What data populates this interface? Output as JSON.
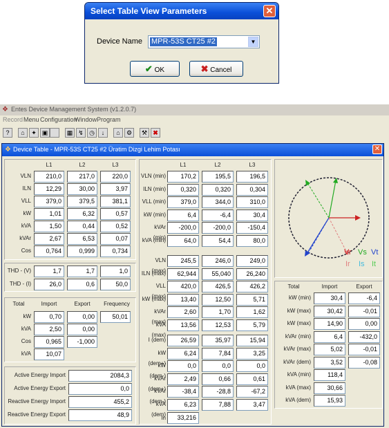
{
  "dialog": {
    "title": "Select Table View Parameters",
    "device_label": "Device Name",
    "device_value": "MPR-53S CT25 #2",
    "ok": "OK",
    "cancel": "Cancel"
  },
  "app": {
    "title": "Entes Device Management System  (v1.2.0.7)",
    "menu": [
      "Record",
      "Menu",
      "Configuration",
      "Window",
      "Program"
    ],
    "child_title": "Device Table - MPR-53S CT25 #2 Ürətim Dizgi Lehim Potası"
  },
  "left": {
    "phase_headers": [
      "L1",
      "L2",
      "L3"
    ],
    "rows": [
      {
        "label": "VLN",
        "values": [
          "210,0",
          "217,0",
          "220,0"
        ]
      },
      {
        "label": "ILN",
        "values": [
          "12,29",
          "30,00",
          "3,97"
        ]
      },
      {
        "label": "VLL",
        "values": [
          "379,0",
          "379,5",
          "381,1"
        ]
      },
      {
        "label": "kW",
        "values": [
          "1,01",
          "6,32",
          "0,57"
        ]
      },
      {
        "label": "kVA",
        "values": [
          "1,50",
          "0,44",
          "0,52"
        ]
      },
      {
        "label": "kVAr",
        "values": [
          "2,67",
          "6,53",
          "0,07"
        ]
      },
      {
        "label": "Cos",
        "values": [
          "0,764",
          "0,999",
          "0,734"
        ]
      }
    ],
    "thd": [
      {
        "label": "THD - (V)",
        "values": [
          "1,7",
          "1,7",
          "1,0"
        ]
      },
      {
        "label": "THD - (I)",
        "values": [
          "26,0",
          "0,6",
          "50,0"
        ]
      }
    ],
    "total_headers": [
      "Total",
      "Import",
      "Export",
      "Frequency"
    ],
    "totals": [
      {
        "label": "kW",
        "values": [
          "0,70",
          "0,00"
        ]
      },
      {
        "label": "kVA",
        "values": [
          "2,50",
          "0,00"
        ]
      },
      {
        "label": "Cos",
        "values": [
          "0,965",
          "-1,000"
        ]
      },
      {
        "label": "kVA",
        "values": [
          "10,07"
        ]
      }
    ],
    "frequency": "50,01",
    "energy": [
      {
        "label": "Active Energy Import",
        "value": "2084,3"
      },
      {
        "label": "Active Energy Export",
        "value": "0,0"
      },
      {
        "label": "Reactive Energy Import",
        "value": "455,2"
      },
      {
        "label": "Reactive Energy Export",
        "value": "48,9"
      }
    ]
  },
  "middle": {
    "phase_headers": [
      "L1",
      "L2",
      "L3"
    ],
    "min_rows": [
      {
        "label": "VLN (min)",
        "values": [
          "170,2",
          "195,5",
          "196,5"
        ]
      },
      {
        "label": "ILN (min)",
        "values": [
          "0,320",
          "0,320",
          "0,304"
        ]
      },
      {
        "label": "VLL (min)",
        "values": [
          "379,0",
          "344,0",
          "310,0"
        ]
      },
      {
        "label": "kW (min)",
        "values": [
          "6,4",
          "-6,4",
          "30,4"
        ]
      },
      {
        "label": "kVAr (min)",
        "values": [
          "-200,0",
          "-200,0",
          "-150,4"
        ]
      },
      {
        "label": "kVA (min)",
        "values": [
          "64,0",
          "54,4",
          "80,0"
        ]
      }
    ],
    "max_rows": [
      {
        "label": "VLN (max)",
        "values": [
          "245,5",
          "246,0",
          "249,0"
        ]
      },
      {
        "label": "ILN (max)",
        "values": [
          "62,944",
          "55,040",
          "26,240"
        ]
      },
      {
        "label": "VLL (max)",
        "values": [
          "420,0",
          "426,5",
          "426,2"
        ]
      },
      {
        "label": "kW (max)",
        "values": [
          "13,40",
          "12,50",
          "5,71"
        ]
      },
      {
        "label": "kVAr (max)",
        "values": [
          "2,60",
          "1,70",
          "1,62"
        ]
      },
      {
        "label": "kVA (max)",
        "values": [
          "13,56",
          "12,53",
          "5,79"
        ]
      }
    ],
    "dem_rows": [
      {
        "label": "I (dem)",
        "values": [
          "26,59",
          "35,97",
          "15,94"
        ]
      },
      {
        "label": "kW (dem+)",
        "values": [
          "6,24",
          "7,84",
          "3,25"
        ]
      },
      {
        "label": "kW (dem-)",
        "values": [
          "0,0",
          "0,0",
          "0,0"
        ]
      },
      {
        "label": "kVAr (dem+)",
        "values": [
          "2,49",
          "0,66",
          "0,61"
        ]
      },
      {
        "label": "kVAr (dem-)",
        "values": [
          "-38,4",
          "-28,8",
          "-67,2"
        ]
      },
      {
        "label": "kVA (dem)",
        "values": [
          "6,23",
          "7,88",
          "3,47"
        ]
      }
    ],
    "in_label": "In",
    "in_value": "33,216"
  },
  "phasor": {
    "legend_v": [
      "Vr",
      "Vs",
      "Vt"
    ],
    "legend_i": [
      "Ir",
      "Is",
      "It"
    ],
    "colors": {
      "r": "#cc2222",
      "s": "#22aa22",
      "t": "#2244cc"
    }
  },
  "right": {
    "headers": [
      "Total",
      "Import",
      "Export"
    ],
    "rows": [
      {
        "label": "kW (min)",
        "values": [
          "30,4",
          "-6,4"
        ]
      },
      {
        "label": "kW (max)",
        "values": [
          "30,42",
          "-0,01"
        ]
      },
      {
        "label": "kW (max)",
        "values": [
          "14,90",
          "0,00"
        ]
      },
      {
        "label": "kVAr (min)",
        "values": [
          "6,4",
          "-432,0"
        ]
      },
      {
        "label": "kVAr (max)",
        "values": [
          "5,02",
          "-0,01"
        ]
      },
      {
        "label": "kVAr (dem)",
        "values": [
          "3,52",
          "-0,08"
        ]
      },
      {
        "label": "kVA (min)",
        "values": [
          "118,4"
        ]
      },
      {
        "label": "kVA (max)",
        "values": [
          "30,66"
        ]
      },
      {
        "label": "kVA (dem)",
        "values": [
          "15,93"
        ]
      }
    ]
  }
}
